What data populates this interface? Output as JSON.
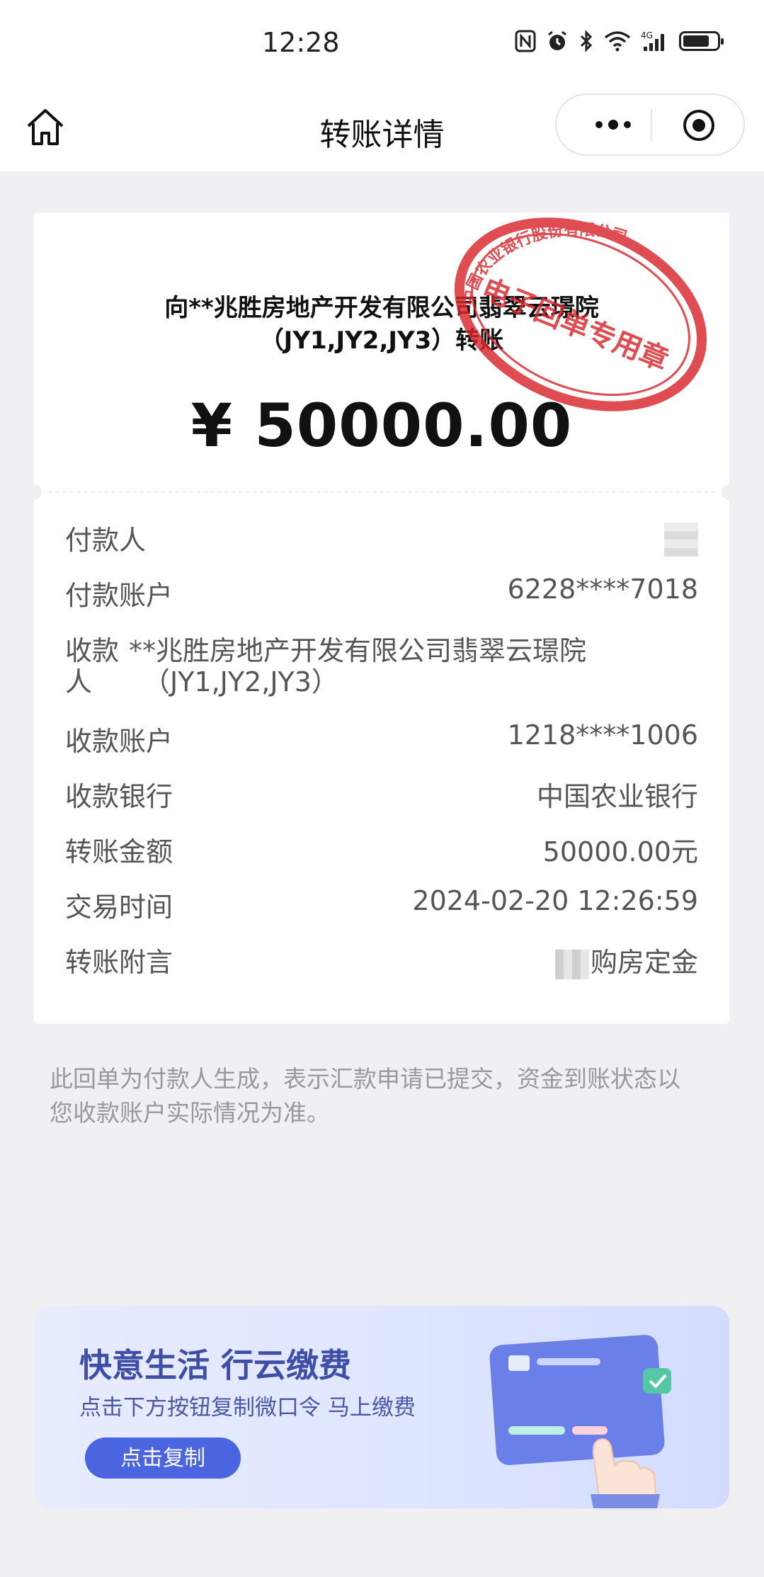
{
  "status_bar": {
    "time": "12:28",
    "icons": [
      "nfc-icon",
      "alarm-icon",
      "bluetooth-icon",
      "wifi-icon",
      "4g-signal-icon",
      "battery-icon"
    ],
    "network": "4G"
  },
  "nav": {
    "title": "转账详情",
    "home_icon": "home-icon",
    "more_icon": "more-dots-icon",
    "close_icon": "target-close-icon"
  },
  "receipt": {
    "title_line1": "向**兆胜房地产开发有限公司翡翠云璟院",
    "title_line2": "（JY1,JY2,JY3）转账",
    "amount": "¥ 50000.00",
    "seal": {
      "top_text": "中国农业银行股份有限公司",
      "bottom_text": "电子回单专用章",
      "color": "#d9262b"
    },
    "rows": {
      "payer_label": "付款人",
      "payer_account_label": "付款账户",
      "payer_account_value": "6228****7018",
      "payee_label_1": "收款",
      "payee_label_2": "人",
      "payee_value_1": "**兆胜房地产开发有限公司翡翠云璟院",
      "payee_value_2": "（JY1,JY2,JY3）",
      "payee_account_label": "收款账户",
      "payee_account_value": "1218****1006",
      "payee_bank_label": "收款银行",
      "payee_bank_value": "中国农业银行",
      "transfer_amount_label": "转账金额",
      "transfer_amount_value": "50000.00元",
      "time_label": "交易时间",
      "time_value": "2024-02-20 12:26:59",
      "remark_label": "转账附言",
      "remark_value": "购房定金"
    }
  },
  "note": "此回单为付款人生成，表示汇款申请已提交，资金到账状态以 您收款账户实际情况为准。",
  "banner": {
    "title": "快意生活 行云缴费",
    "subtitle": "点击下方按钮复制微口令 马上缴费",
    "button_label": "点击复制",
    "accent": "#4b64e0"
  }
}
